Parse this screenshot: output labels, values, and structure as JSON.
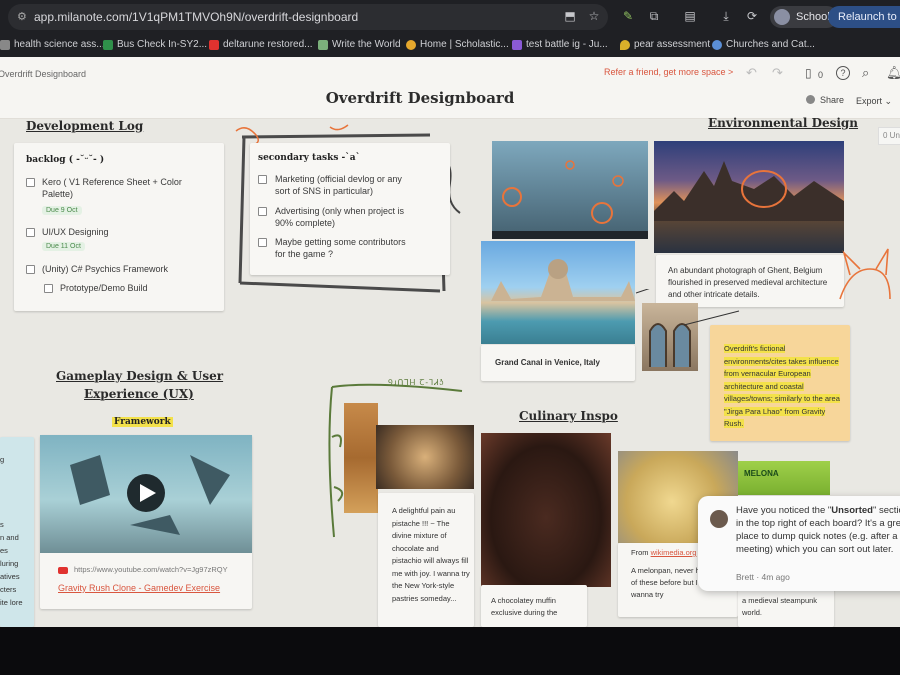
{
  "browser": {
    "url": "app.milanote.com/1V1qPM1TMVOh9N/overdrift-designboard",
    "profile_label": "School",
    "relaunch_label": "Relaunch to upd",
    "bookmarks": [
      {
        "label": "health science ass..."
      },
      {
        "label": "Bus Check In-SY2..."
      },
      {
        "label": "deltarune restored..."
      },
      {
        "label": "Write the World"
      },
      {
        "label": "Home | Scholastic..."
      },
      {
        "label": "test battle ig - Ju..."
      },
      {
        "label": "pear assessment"
      },
      {
        "label": "Churches and Cat..."
      }
    ]
  },
  "app": {
    "breadcrumb": "Overdrift Designboard",
    "refer_link": "Refer a friend, get more space >",
    "device_count": "0",
    "board_title": "Overdrift Designboard",
    "share_label": "Share",
    "export_label": "Export",
    "unsorted_count": "0"
  },
  "board": {
    "dev_log": {
      "heading": "Development Log",
      "card_title": "backlog ( -˘ᵕ˘- )",
      "tasks": [
        {
          "label": "Kero ( V1 Reference Sheet + Color Palette)",
          "due": "Due 9 Oct"
        },
        {
          "label": "UI/UX Designing",
          "due": "Due 11 Oct"
        },
        {
          "label": "(Unity)  C# Psychics Framework",
          "due": ""
        },
        {
          "label": "Prototype/Demo Build",
          "due": ""
        }
      ]
    },
    "secondary": {
      "title": "secondary tasks -`a`",
      "tasks": [
        {
          "label": "Marketing (official devlog or any sort of SNS in particular)"
        },
        {
          "label": "Advertising (only when project is 90% complete)"
        },
        {
          "label": "Maybe getting some contributors for the game ?"
        }
      ]
    },
    "env": {
      "heading": "Environmental Design",
      "venice_caption": "Grand Canal in Venice, Italy",
      "ghent_caption": "An abundant photograph of Ghent, Belgium flourished in preserved medieval architecture and other intricate details.",
      "note": "Overdrift's fictional environments/cites takes influence from vernacular European architecture and coastal villages/towns; similarly to the area \"Jirga Para Lhao\" from Gravity Rush."
    },
    "gameplay": {
      "heading_line1": "Gameplay Design & User",
      "heading_line2": "Experience (UX)",
      "framework_label": "Framework",
      "video_url": "https://www.youtube.com/watch?v=Jg97zRQY",
      "video_title": "Gravity Rush Clone - Gamedev Exercise",
      "side_texts": [
        "g",
        "s",
        "n and",
        "es",
        "luring",
        "atives",
        "cters",
        "ite lore"
      ]
    },
    "culinary": {
      "heading": "Culinary Inspo",
      "handwritten": "ꝮɹՈꞀᎻ Ꞇ-ꞀᏗᎼ",
      "pistache": "A delightful pain au pistache !!! ~ The divine mixture of chocolate and pistachio will always fill me with joy. I wanna try the New York-style pastries someday...",
      "muffin": "A chocolatey muffin exclusive during the",
      "wiki_prefix": "From",
      "wiki_link": "wikimedia.org",
      "melonpan": "A melonpan, never had one of these before but I always wanna try",
      "melona_label": "MELONA",
      "steampunk": "a medieval steampunk world."
    },
    "toast": {
      "text_before": "Have you noticed the \"",
      "bold": "Unsorted",
      "text_after": "\" section in the top right of each board? It's a great place to dump quick notes (e.g. after a meeting) which you can sort out later.",
      "author": "Brett",
      "time": "4m ago"
    }
  },
  "colors": {
    "accent_orange": "#e8743b",
    "note_yellow": "#f7d69a",
    "highlight": "#f3e14a",
    "link_red": "#d9563f"
  }
}
